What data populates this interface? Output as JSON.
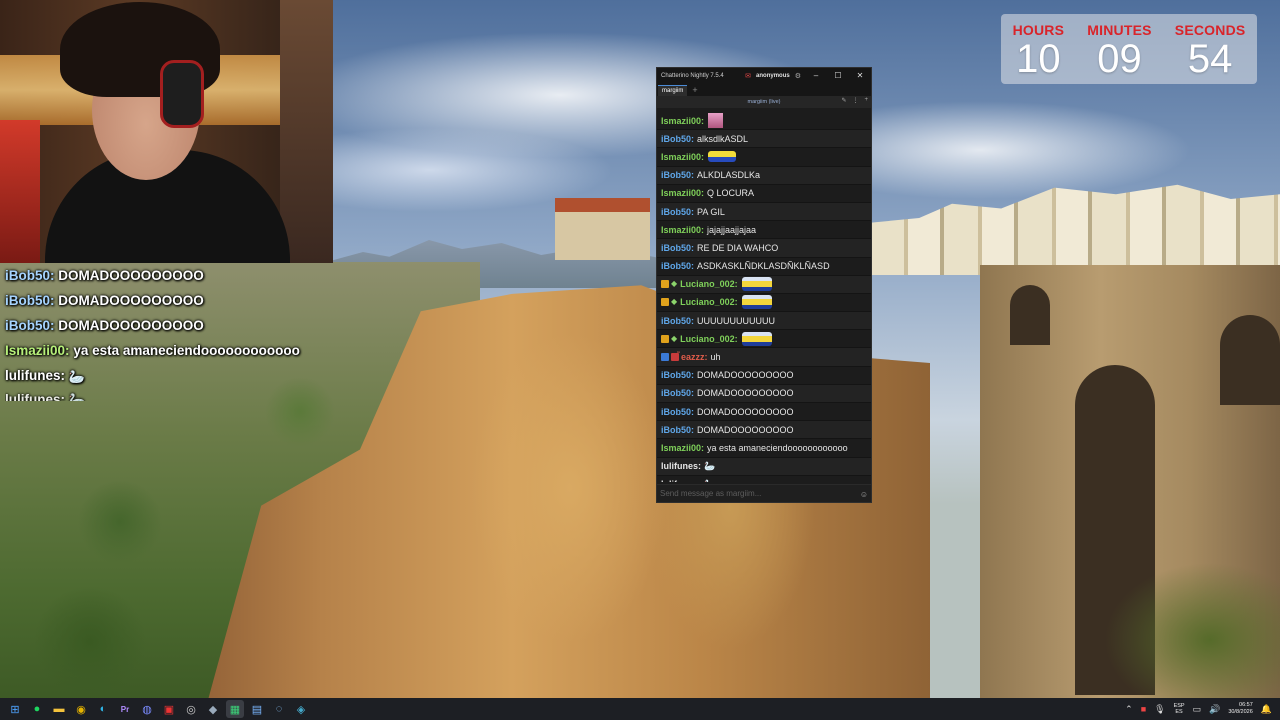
{
  "timer": {
    "hours_label": "HOURS",
    "minutes_label": "MINUTES",
    "seconds_label": "SECONDS",
    "hours": "10",
    "minutes": "09",
    "seconds": "54",
    "label_color": "#d9242a"
  },
  "overlay_chat": [
    {
      "user": "iBob50:",
      "text": "DOMADOOOOOOOOO",
      "color": "blue"
    },
    {
      "user": "iBob50:",
      "text": "DOMADOOOOOOOOO",
      "color": "blue"
    },
    {
      "user": "iBob50:",
      "text": "DOMADOOOOOOOOO",
      "color": "blue"
    },
    {
      "user": "Ismazii00:",
      "text": "ya esta amaneciendoooooooooooo",
      "color": "green"
    },
    {
      "user": "lulifunes:",
      "text": "",
      "color": "white"
    },
    {
      "user": "lulifunes:",
      "text": "",
      "color": "white"
    }
  ],
  "chatterino": {
    "title": "Chatterino Nightly 7.5.4",
    "account": "anonymous",
    "tab": "margiim",
    "add_tab": "+",
    "split_header": "margiim (live)",
    "input_placeholder": "Send message as margiim...",
    "messages": [
      {
        "user": "Ismazii00:",
        "text": "",
        "color": "green",
        "emote": "pink"
      },
      {
        "user": "iBob50:",
        "text": "alksdlkASDL",
        "color": "blue"
      },
      {
        "user": "Ismazii00:",
        "text": "",
        "color": "green",
        "emote": "car"
      },
      {
        "user": "iBob50:",
        "text": "ALKDLASDLKa",
        "color": "blue"
      },
      {
        "user": "Ismazii00:",
        "text": "Q LOCURA",
        "color": "green"
      },
      {
        "user": "iBob50:",
        "text": "PA GIL",
        "color": "blue"
      },
      {
        "user": "Ismazii00:",
        "text": "jajajjaajjajaa",
        "color": "green"
      },
      {
        "user": "iBob50:",
        "text": "RE DE DIA WAHCO",
        "color": "blue"
      },
      {
        "user": "iBob50:",
        "text": "ASDKASKLÑDKLASDÑKLÑASD",
        "color": "blue"
      },
      {
        "user": "Luciano_002:",
        "text": "",
        "color": "green",
        "badges": [
          "gold",
          "green"
        ],
        "emote": "bigcar"
      },
      {
        "user": "Luciano_002:",
        "text": "",
        "color": "green",
        "badges": [
          "gold",
          "green"
        ],
        "emote": "bigcar"
      },
      {
        "user": "iBob50:",
        "text": "UUUUUUUUUUUU",
        "color": "blue"
      },
      {
        "user": "Luciano_002:",
        "text": "",
        "color": "green",
        "badges": [
          "gold",
          "green"
        ],
        "emote": "bigcar"
      },
      {
        "user": "̃eazzz:",
        "text": "uh",
        "color": "red",
        "badges": [
          "blue",
          "red"
        ]
      },
      {
        "user": "iBob50:",
        "text": "DOMADOOOOOOOOO",
        "color": "blue"
      },
      {
        "user": "iBob50:",
        "text": "DOMADOOOOOOOOO",
        "color": "blue"
      },
      {
        "user": "iBob50:",
        "text": "DOMADOOOOOOOOO",
        "color": "blue"
      },
      {
        "user": "iBob50:",
        "text": "DOMADOOOOOOOOO",
        "color": "blue"
      },
      {
        "user": "Ismazii00:",
        "text": "ya esta amaneciendoooooooooooo",
        "color": "green"
      },
      {
        "user": "lulifunes:",
        "text": "",
        "color": "white"
      },
      {
        "user": "lulifunes:",
        "text": "",
        "color": "white"
      }
    ]
  },
  "taskbar": {
    "language": "ESP",
    "region": "ES",
    "time": "06:57",
    "date": "30/8/2026"
  }
}
